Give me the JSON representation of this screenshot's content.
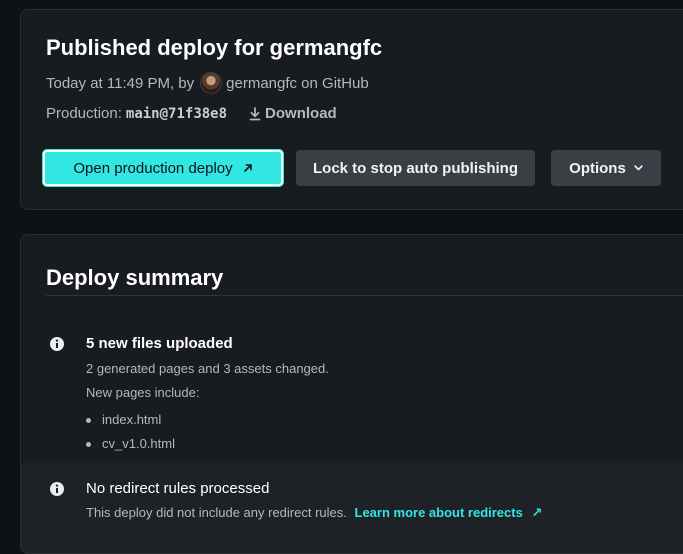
{
  "deploy": {
    "title": "Published deploy for germangfc",
    "meta_prefix": "Today at 11:49 PM, by",
    "meta_suffix": "germangfc on GitHub",
    "production_label": "Production:",
    "production_ref": "main@71f38e8",
    "download_label": "Download"
  },
  "actions": {
    "open_label": "Open production deploy",
    "lock_label": "Lock to stop auto publishing",
    "options_label": "Options"
  },
  "summary": {
    "title": "Deploy summary",
    "items": [
      {
        "heading": "5 new files uploaded",
        "line1": "2 generated pages and 3 assets changed.",
        "line2": "New pages include:",
        "pages": [
          "index.html",
          "cv_v1.0.html"
        ]
      },
      {
        "heading": "No redirect rules processed",
        "line1": "This deploy did not include any redirect rules.",
        "link": "Learn more about redirects",
        "link_icon": "↗"
      }
    ]
  },
  "icons": {
    "open_arrow": "arrow-up-right-icon",
    "download": "download-icon",
    "options_chevron": "chevron-down-icon",
    "info": "info-circle-icon"
  },
  "colors": {
    "accent": "#32e6e2",
    "card_bg": "#181b20",
    "page_bg": "#0e1217",
    "button_secondary": "#3a3f46"
  }
}
